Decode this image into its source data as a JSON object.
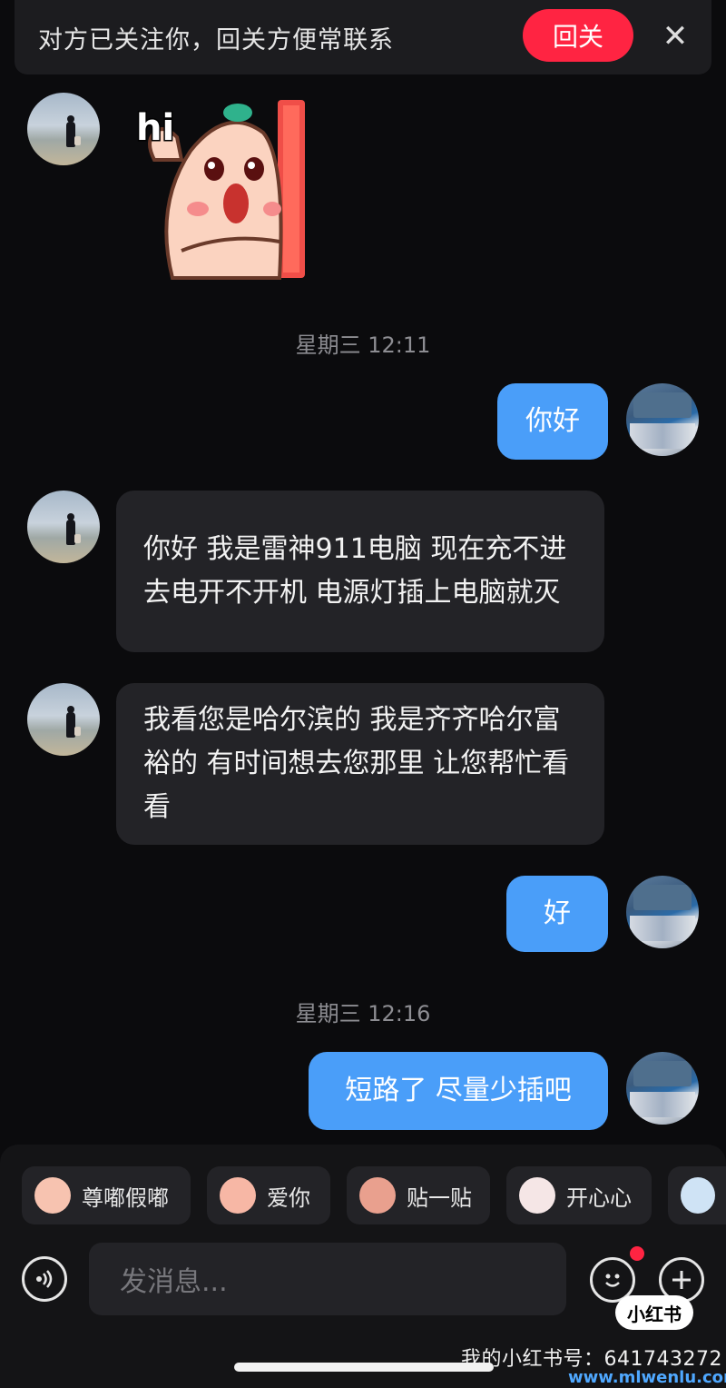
{
  "banner": {
    "text": "对方已关注你，回关方便常联系",
    "follow_label": "回关",
    "close_icon": "close-icon"
  },
  "sticker": {
    "label": "hi"
  },
  "timestamps": [
    "星期三 12:11",
    "星期三 12:16"
  ],
  "messages": [
    {
      "from": "self",
      "text": "你好"
    },
    {
      "from": "other",
      "text": "你好 我是雷神911电脑  现在充不进去电开不开机 电源灯插上电脑就灭"
    },
    {
      "from": "other",
      "text": "我看您是哈尔滨的 我是齐齐哈尔富裕的 有时间想去您那里 让您帮忙看看"
    },
    {
      "from": "self",
      "text": "好"
    },
    {
      "from": "self",
      "text": "短路了 尽量少插吧"
    }
  ],
  "quick_replies": [
    "尊嘟假嘟",
    "爱你",
    "贴一贴",
    "开心心"
  ],
  "input": {
    "placeholder": "发消息..."
  },
  "footer": {
    "logo_text": "小红书",
    "account_text": "我的小红书号：641743272",
    "watermark": "www.mlwenlu.com"
  },
  "colors": {
    "accent_red": "#ff2442",
    "bubble_blue": "#4a9ef9",
    "background": "#0b0b0d"
  }
}
